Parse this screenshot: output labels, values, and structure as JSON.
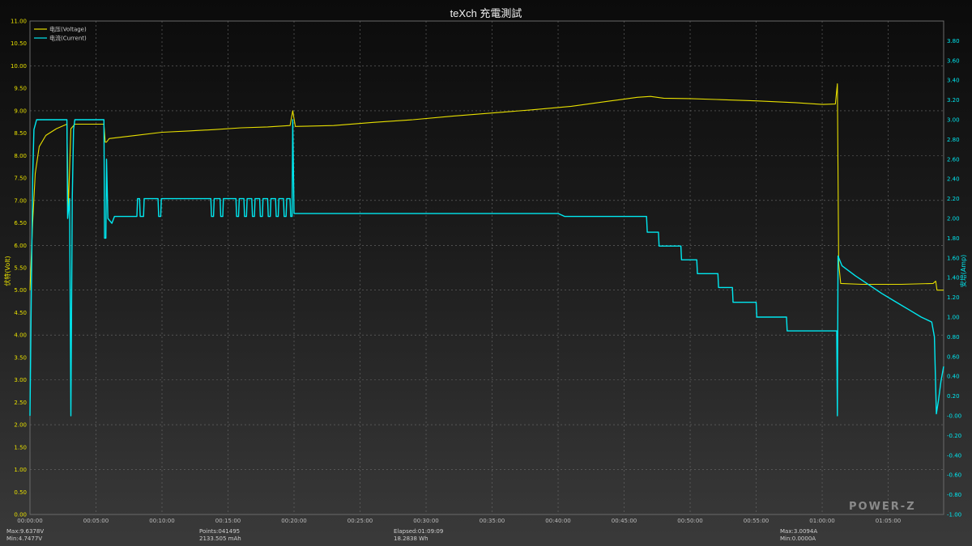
{
  "chart_data": {
    "type": "line",
    "title": "teXch 充電測試",
    "ylabel_left": "伏特(Volt)",
    "ylabel_right": "安培(Amp)",
    "left_ylim": [
      0,
      11
    ],
    "right_ylim": [
      -1,
      4
    ],
    "left_ticks": [
      "0.00",
      "0.50",
      "1.00",
      "1.50",
      "2.00",
      "2.50",
      "3.00",
      "3.50",
      "4.00",
      "4.50",
      "5.00",
      "5.50",
      "6.00",
      "6.50",
      "7.00",
      "7.50",
      "8.00",
      "8.50",
      "9.00",
      "9.50",
      "10.00",
      "10.50",
      "11.00"
    ],
    "right_ticks": [
      "-1.00",
      "-0.80",
      "-0.60",
      "-0.40",
      "-0.20",
      "-0.00",
      "0.20",
      "0.40",
      "0.60",
      "0.80",
      "1.00",
      "1.20",
      "1.40",
      "1.60",
      "1.80",
      "2.00",
      "2.20",
      "2.40",
      "2.60",
      "2.80",
      "3.00",
      "3.20",
      "3.40",
      "3.60",
      "3.80"
    ],
    "x_ticks": [
      "00:00:00",
      "00:05:00",
      "00:10:00",
      "00:15:00",
      "00:20:00",
      "00:25:00",
      "00:30:00",
      "00:35:00",
      "00:40:00",
      "00:45:00",
      "00:50:00",
      "00:55:00",
      "01:00:00",
      "01:05:00"
    ],
    "x_unit": "minutes",
    "xlim": [
      0,
      69.2
    ],
    "grid": true,
    "legend_position": "top-left",
    "series": [
      {
        "name": "电压(Voltage)",
        "axis": "left",
        "color": "#e8e000",
        "points": [
          [
            0,
            5.0
          ],
          [
            0.2,
            6.5
          ],
          [
            0.4,
            7.6
          ],
          [
            0.7,
            8.2
          ],
          [
            1.2,
            8.45
          ],
          [
            2,
            8.6
          ],
          [
            2.8,
            8.7
          ],
          [
            2.9,
            6.8
          ],
          [
            3.1,
            8.6
          ],
          [
            3.4,
            8.7
          ],
          [
            5.6,
            8.7
          ],
          [
            5.7,
            8.3
          ],
          [
            5.8,
            8.3
          ],
          [
            6,
            8.38
          ],
          [
            8,
            8.45
          ],
          [
            10,
            8.52
          ],
          [
            12,
            8.55
          ],
          [
            14,
            8.58
          ],
          [
            16,
            8.62
          ],
          [
            18,
            8.64
          ],
          [
            19.7,
            8.67
          ],
          [
            19.9,
            9.0
          ],
          [
            20.1,
            8.65
          ],
          [
            23,
            8.67
          ],
          [
            26,
            8.74
          ],
          [
            29,
            8.8
          ],
          [
            32,
            8.88
          ],
          [
            35,
            8.95
          ],
          [
            38,
            9.02
          ],
          [
            41,
            9.1
          ],
          [
            44,
            9.22
          ],
          [
            46,
            9.3
          ],
          [
            47,
            9.32
          ],
          [
            48,
            9.28
          ],
          [
            50,
            9.27
          ],
          [
            52,
            9.25
          ],
          [
            55,
            9.22
          ],
          [
            58,
            9.18
          ],
          [
            60,
            9.14
          ],
          [
            61,
            9.15
          ],
          [
            61.15,
            9.6
          ],
          [
            61.25,
            5.6
          ],
          [
            61.4,
            5.15
          ],
          [
            63,
            5.13
          ],
          [
            66,
            5.13
          ],
          [
            68.4,
            5.15
          ],
          [
            68.6,
            5.2
          ],
          [
            68.7,
            5.0
          ],
          [
            69.2,
            5.0
          ]
        ]
      },
      {
        "name": "电流(Current)",
        "axis": "right",
        "color": "#00e8f0",
        "points": [
          [
            0,
            0
          ],
          [
            0.1,
            1.2
          ],
          [
            0.2,
            2.4
          ],
          [
            0.3,
            2.9
          ],
          [
            0.5,
            3.0
          ],
          [
            2.8,
            3.0
          ],
          [
            2.85,
            2.0
          ],
          [
            3.0,
            2.2
          ],
          [
            3.1,
            0
          ],
          [
            3.2,
            2.2
          ],
          [
            3.3,
            2.9
          ],
          [
            3.4,
            3.0
          ],
          [
            5.6,
            3.0
          ],
          [
            5.65,
            1.8
          ],
          [
            5.75,
            1.8
          ],
          [
            5.8,
            2.6
          ],
          [
            5.9,
            2.0
          ],
          [
            6.2,
            1.95
          ],
          [
            6.4,
            2.02
          ],
          [
            8.1,
            2.02
          ],
          [
            8.15,
            2.2
          ],
          [
            8.3,
            2.2
          ],
          [
            8.35,
            2.02
          ],
          [
            8.6,
            2.02
          ],
          [
            8.65,
            2.2
          ],
          [
            9.7,
            2.2
          ],
          [
            9.75,
            2.02
          ],
          [
            9.9,
            2.02
          ],
          [
            9.95,
            2.2
          ],
          [
            13.7,
            2.2
          ],
          [
            13.75,
            2.02
          ],
          [
            13.9,
            2.02
          ],
          [
            13.95,
            2.2
          ],
          [
            14.4,
            2.2
          ],
          [
            14.45,
            2.02
          ],
          [
            14.6,
            2.02
          ],
          [
            14.65,
            2.2
          ],
          [
            15.6,
            2.2
          ],
          [
            15.65,
            2.02
          ],
          [
            15.8,
            2.02
          ],
          [
            15.85,
            2.2
          ],
          [
            16.2,
            2.2
          ],
          [
            16.25,
            2.02
          ],
          [
            16.4,
            2.02
          ],
          [
            16.45,
            2.2
          ],
          [
            16.8,
            2.2
          ],
          [
            16.85,
            2.02
          ],
          [
            17.0,
            2.02
          ],
          [
            17.05,
            2.2
          ],
          [
            17.4,
            2.2
          ],
          [
            17.45,
            2.02
          ],
          [
            17.6,
            2.02
          ],
          [
            17.65,
            2.2
          ],
          [
            18.0,
            2.2
          ],
          [
            18.05,
            2.02
          ],
          [
            18.2,
            2.02
          ],
          [
            18.25,
            2.2
          ],
          [
            18.6,
            2.2
          ],
          [
            18.65,
            2.02
          ],
          [
            18.8,
            2.02
          ],
          [
            18.85,
            2.2
          ],
          [
            19.2,
            2.2
          ],
          [
            19.25,
            2.02
          ],
          [
            19.4,
            2.02
          ],
          [
            19.45,
            2.2
          ],
          [
            19.7,
            2.2
          ],
          [
            19.75,
            2.02
          ],
          [
            19.85,
            2.02
          ],
          [
            19.9,
            3.0
          ],
          [
            20.0,
            2.05
          ],
          [
            40,
            2.05
          ],
          [
            40.5,
            2.02
          ],
          [
            46.7,
            2.02
          ],
          [
            46.75,
            1.86
          ],
          [
            47.6,
            1.86
          ],
          [
            47.65,
            1.72
          ],
          [
            49.3,
            1.72
          ],
          [
            49.35,
            1.58
          ],
          [
            50.5,
            1.58
          ],
          [
            50.55,
            1.44
          ],
          [
            52.1,
            1.44
          ],
          [
            52.15,
            1.3
          ],
          [
            53.2,
            1.3
          ],
          [
            53.25,
            1.15
          ],
          [
            55.0,
            1.15
          ],
          [
            55.05,
            1.0
          ],
          [
            57.3,
            1.0
          ],
          [
            57.35,
            0.86
          ],
          [
            61.1,
            0.86
          ],
          [
            61.15,
            0
          ],
          [
            61.2,
            1.62
          ],
          [
            61.5,
            1.52
          ],
          [
            62.5,
            1.42
          ],
          [
            63.5,
            1.33
          ],
          [
            64.5,
            1.24
          ],
          [
            65.5,
            1.16
          ],
          [
            66.5,
            1.08
          ],
          [
            67.5,
            1.0
          ],
          [
            68.3,
            0.95
          ],
          [
            68.5,
            0.8
          ],
          [
            68.65,
            0.02
          ],
          [
            68.8,
            0.15
          ],
          [
            69.0,
            0.35
          ],
          [
            69.2,
            0.5
          ]
        ]
      }
    ]
  },
  "stats": {
    "max_voltage": "Max:9.6378V",
    "min_voltage": "Min:4.7477V",
    "points": "Points:041495",
    "capacity_mah": "2133.505 mAh",
    "elapsed": "Elapsed:01:09:09",
    "energy_wh": "18.2838 Wh",
    "max_current": "Max:3.0094A",
    "min_current": "Min:0.0000A"
  },
  "brand": "POWER-Z"
}
